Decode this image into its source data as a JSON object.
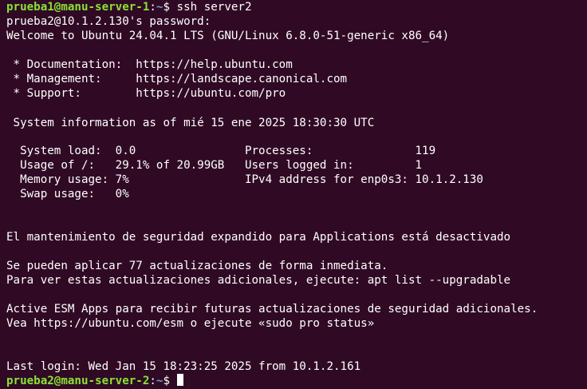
{
  "terminal": {
    "background_color": "#300a24",
    "prompt_user_color": "#8ae234",
    "prompt_path_color": "#729fcf",
    "line1": {
      "user": "prueba1@manu-server-1",
      "sep": ":",
      "path": "~",
      "command": "$ ssh server2"
    },
    "password_prompt": "prueba2@10.1.2.130's password:",
    "welcome": "Welcome to Ubuntu 24.04.1 LTS (GNU/Linux 6.8.0-51-generic x86_64)",
    "links": [
      " * Documentation:  https://help.ubuntu.com",
      " * Management:     https://landscape.canonical.com",
      " * Support:        https://ubuntu.com/pro"
    ],
    "sysinfo_header": " System information as of mié 15 ene 2025 18:30:30 UTC",
    "sysinfo": [
      "  System load:  0.0                Processes:               119",
      "  Usage of /:   29.1% of 20.99GB   Users logged in:         1",
      "  Memory usage: 7%                 IPv4 address for enp0s3: 10.1.2.130",
      "  Swap usage:   0%"
    ],
    "esm_notice": "El mantenimiento de seguridad expandido para Applications está desactivado",
    "updates": [
      "Se pueden aplicar 77 actualizaciones de forma inmediata.",
      "Para ver estas actualizaciones adicionales, ejecute: apt list --upgradable"
    ],
    "esm_apps": [
      "Active ESM Apps para recibir futuras actualizaciones de seguridad adicionales.",
      "Vea https://ubuntu.com/esm o ejecute «sudo pro status»"
    ],
    "last_login": "Last login: Wed Jan 15 18:23:25 2025 from 10.1.2.161",
    "final_prompt": {
      "user": "prueba2@manu-server-2",
      "sep": ":",
      "path": "~",
      "symbol": "$ "
    }
  }
}
